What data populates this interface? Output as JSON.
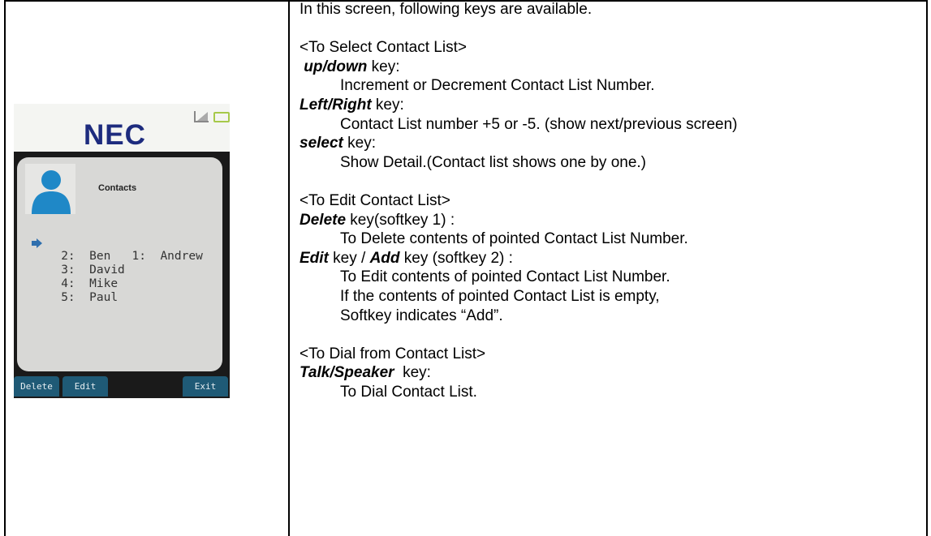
{
  "phone": {
    "logo": "NEC",
    "panel_title": "Contacts",
    "contacts": [
      {
        "num": "1:",
        "name": "Andrew",
        "selected": true
      },
      {
        "num": "2:",
        "name": "Ben"
      },
      {
        "num": "3:",
        "name": "David"
      },
      {
        "num": "4:",
        "name": "Mike"
      },
      {
        "num": "5:",
        "name": "Paul"
      }
    ],
    "softkeys": {
      "delete": "Delete",
      "edit": "Edit",
      "exit": "Exit"
    },
    "icons": [
      "signal-icon",
      "battery-icon",
      "avatar-icon",
      "pointer-arrow-icon"
    ],
    "colors": {
      "logo": "#1d2b7e",
      "softkey_bg": "#1f5a76",
      "avatar": "#1f88c7",
      "battery": "#a6c94a"
    }
  },
  "text": {
    "intro": "In this screen, following keys are available.",
    "select_header": "<To Select Contact List>",
    "updown_key": "up/down",
    "updown_suffix": " key:",
    "updown_desc": "Increment or Decrement Contact List Number.",
    "leftright_key": "Left/Right",
    "leftright_suffix": " key:",
    "leftright_desc": "Contact List number +5 or -5. (show next/previous screen)",
    "select_key": "select",
    "select_suffix": " key:",
    "select_desc": "Show Detail.(Contact list shows one by one.)",
    "edit_header": "<To Edit Contact List>",
    "delete_key": "Delete",
    "delete_suffix": " key(softkey 1) :",
    "delete_desc": "To Delete contents of pointed Contact List Number.",
    "edit_key": "Edit",
    "edit_mid": " key / ",
    "add_key": "Add",
    "add_suffix": " key (softkey 2) :",
    "edit_desc1": "To Edit contents of pointed Contact List Number.",
    "edit_desc2": "If the contents of pointed Contact List is empty,",
    "edit_desc3": "Softkey indicates “Add”.",
    "dial_header": "<To Dial from Contact List>",
    "talk_key": "Talk/Speaker",
    "talk_suffix": "  key:",
    "talk_desc": "To Dial Contact List."
  }
}
